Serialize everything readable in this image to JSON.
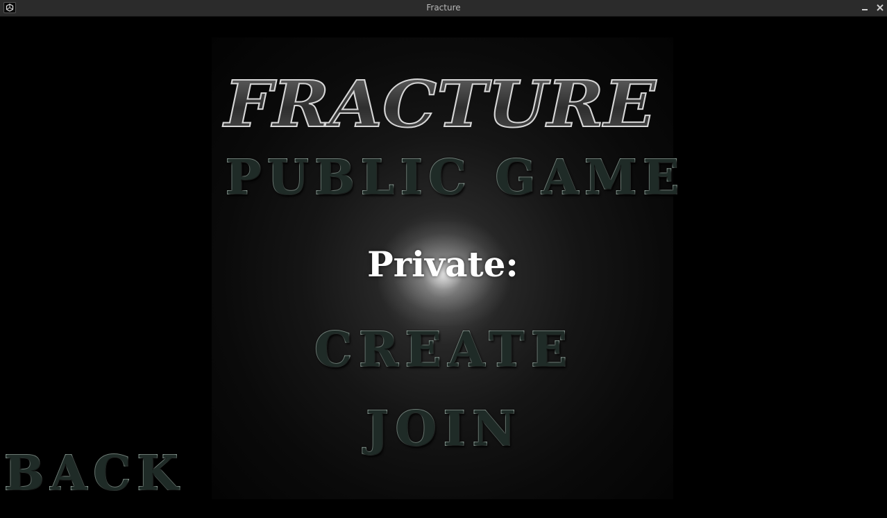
{
  "window": {
    "title": "Fracture",
    "icon": "unity-icon",
    "controls": [
      "minimize-icon",
      "close-icon"
    ]
  },
  "logo": {
    "text": "FRACTURE"
  },
  "menu": {
    "public_game": "PUBLIC GAME",
    "private_label": "Private:",
    "create": "CREATE",
    "join": "JOIN",
    "back": "BACK"
  },
  "colors": {
    "button_fill": "#1f2b27",
    "button_outline": "#a8bdb4",
    "logo_fill": "#3a3a3a",
    "logo_outline": "#d0d0d0",
    "background": "#000000",
    "titlebar": "#2b2b2b"
  }
}
